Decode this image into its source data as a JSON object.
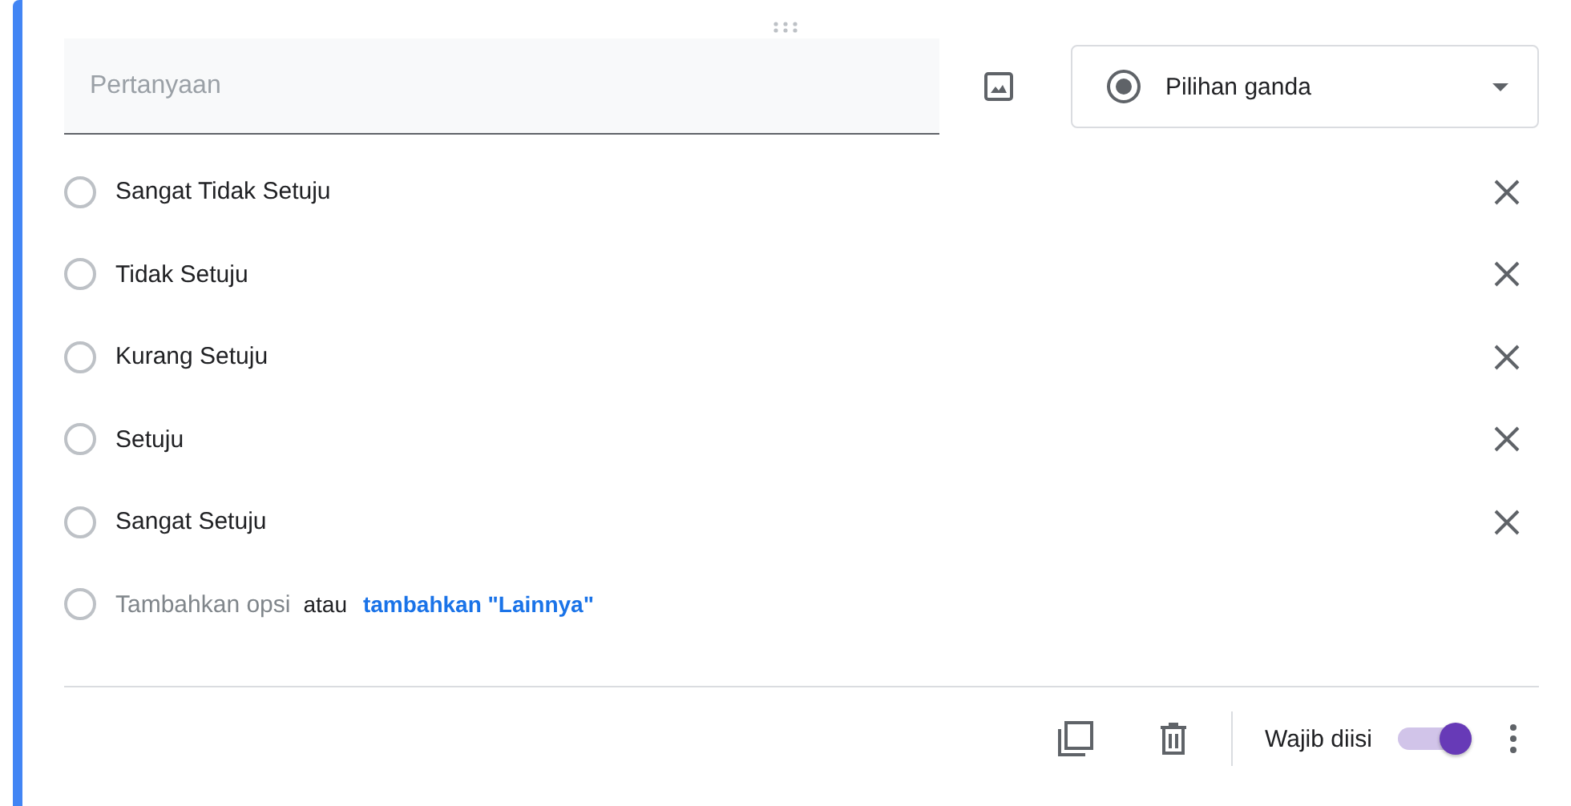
{
  "question": {
    "placeholder": "Pertanyaan"
  },
  "type_select": {
    "label": "Pilihan ganda"
  },
  "options": [
    {
      "label": "Sangat Tidak Setuju",
      "selected": false
    },
    {
      "label": "Tidak Setuju",
      "selected": false
    },
    {
      "label": "Kurang Setuju",
      "selected": false
    },
    {
      "label": "Setuju",
      "selected": false
    },
    {
      "label": "Sangat Setuju",
      "selected": false
    }
  ],
  "add_option": {
    "selected": false,
    "label": "Tambahkan opsi",
    "separator": "atau",
    "other_link": "tambahkan \"Lainnya\""
  },
  "footer": {
    "required_label": "Wajib diisi",
    "required_on": true
  }
}
